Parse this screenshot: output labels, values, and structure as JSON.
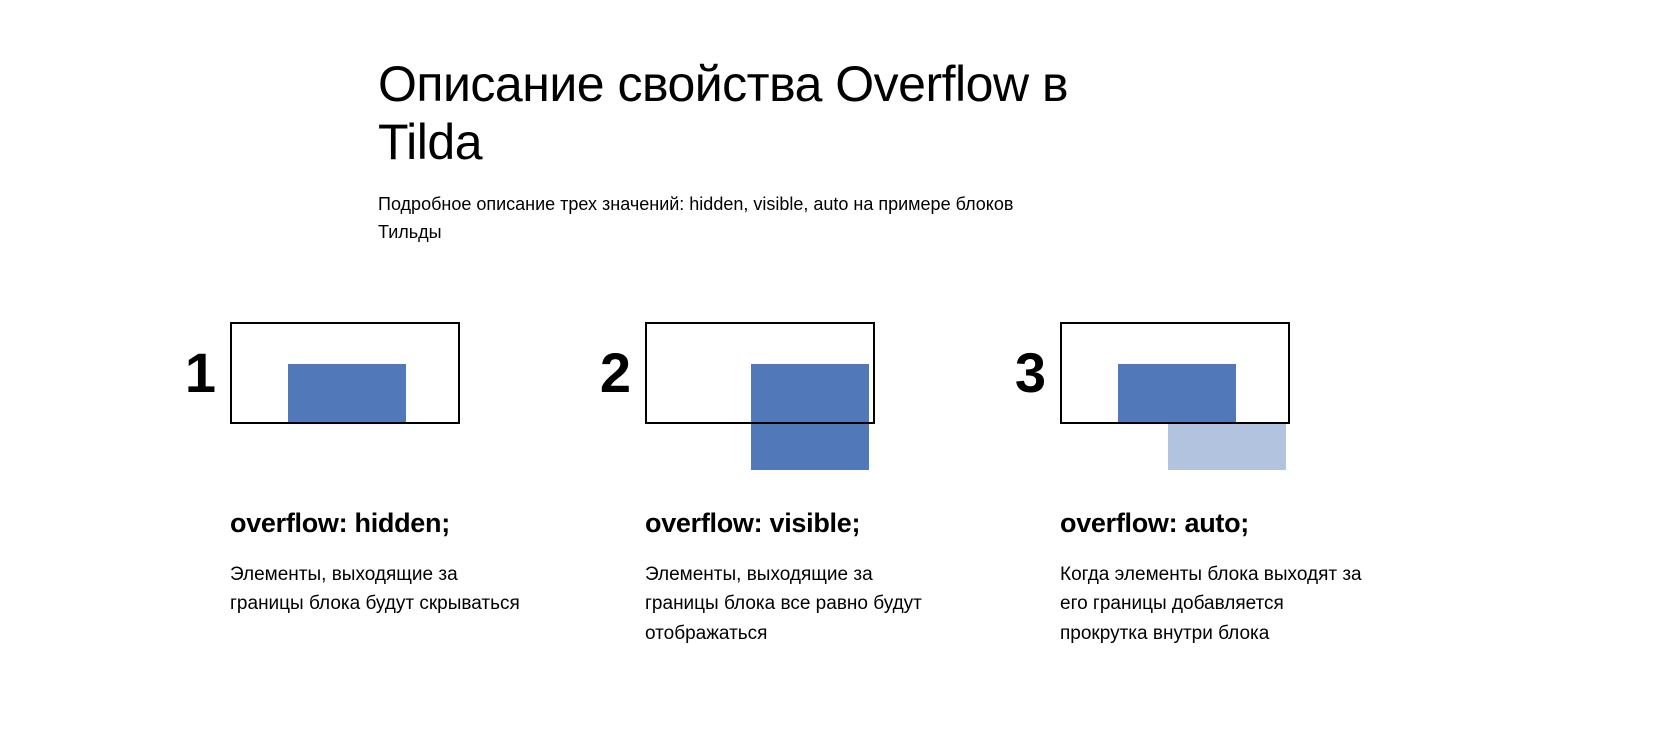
{
  "header": {
    "title": "Описание свойства Overflow в Tilda",
    "subtitle": "Подробное описание трех значений: hidden, visible, auto на примере блоков Тильды"
  },
  "cards": [
    {
      "number": "1",
      "heading": "overflow: hidden;",
      "desc": "Элементы, выходящие за границы блока будут скрываться"
    },
    {
      "number": "2",
      "heading": "overflow: visible;",
      "desc": "Элементы, выходящие за границы блока все равно будут отображаться"
    },
    {
      "number": "3",
      "heading": "overflow: auto;",
      "desc": "Когда элементы блока выходят за его границы добавляется прокрутка внутри блока"
    }
  ],
  "colors": {
    "inner_rect": "#5179b9"
  }
}
